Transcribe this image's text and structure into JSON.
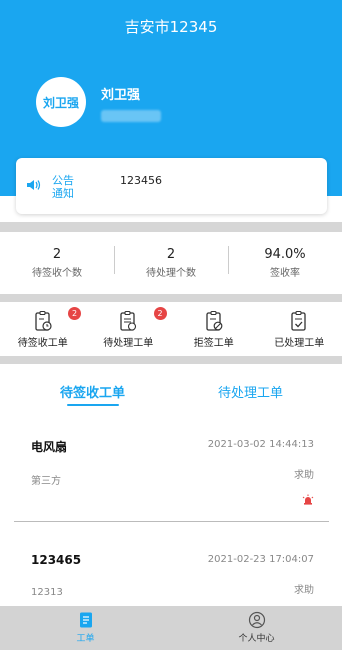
{
  "app": {
    "title": "吉安市12345"
  },
  "user": {
    "avatar_text": "刘卫强",
    "name": "刘卫强"
  },
  "notice": {
    "label": "公告通知",
    "text": "123456"
  },
  "stats": [
    {
      "value": "2",
      "label": "待签收个数"
    },
    {
      "value": "2",
      "label": "待处理个数"
    },
    {
      "value": "94.0%",
      "label": "签收率"
    }
  ],
  "actions": [
    {
      "label": "待签收工单",
      "badge": "2",
      "icon": "clipboard-clock-icon"
    },
    {
      "label": "待处理工单",
      "badge": "2",
      "icon": "clipboard-list-icon"
    },
    {
      "label": "拒签工单",
      "icon": "clipboard-block-icon"
    },
    {
      "label": "已处理工单",
      "icon": "clipboard-check-icon"
    }
  ],
  "tabs": {
    "pending_sign": "待签收工单",
    "pending_process": "待处理工单"
  },
  "orders": [
    {
      "title": "电风扇",
      "date": "2021-03-02 14:44:13",
      "source": "第三方",
      "status": "求助",
      "alert_icon": "alarm-icon"
    },
    {
      "title": "123465",
      "date": "2021-02-23 17:04:07",
      "source": "12313",
      "status": "求助"
    }
  ],
  "tabbar": {
    "orders": "工单",
    "profile": "个人中心"
  },
  "colors": {
    "accent": "#1AA6F0",
    "badge": "#E64545",
    "tabbar_bg": "#D3D3D3"
  }
}
